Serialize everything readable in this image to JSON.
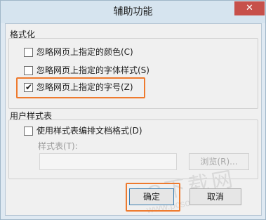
{
  "window": {
    "title": "辅助功能",
    "close_label": "✕"
  },
  "formatting": {
    "group_label": "格式化",
    "options": [
      {
        "label": "忽略网页上指定的颜色(C)",
        "checked": false
      },
      {
        "label": "忽略网页上指定的字体样式(S)",
        "checked": false
      },
      {
        "label": "忽略网页上指定的字号(Z)",
        "checked": true
      }
    ]
  },
  "user_stylesheet": {
    "group_label": "用户样式表",
    "use_label": "使用样式表编排文档格式(D)",
    "use_checked": false,
    "field_label": "样式表(T):",
    "field_value": "",
    "browse_label": "浏览(R)..."
  },
  "buttons": {
    "ok_label": "确定",
    "cancel_label": "取消"
  },
  "watermark": {
    "line1": "PC下载网",
    "line2": "www.pcsoft.com.cn"
  },
  "colors": {
    "highlight": "#ee7a2e",
    "titlebar": "#d6e4ef",
    "close": "#c7504a"
  }
}
